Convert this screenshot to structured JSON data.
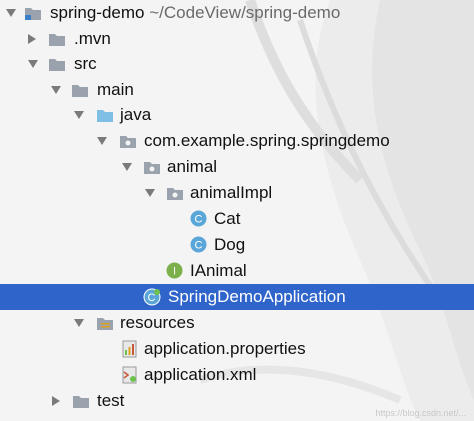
{
  "project": {
    "name": "spring-demo",
    "path": "~/CodeView/spring-demo"
  },
  "items": [
    {
      "label": ".mvn"
    },
    {
      "label": "src"
    },
    {
      "label": "main"
    },
    {
      "label": "java"
    },
    {
      "label": "com.example.spring.springdemo"
    },
    {
      "label": "animal"
    },
    {
      "label": "animalImpl"
    },
    {
      "label": "Cat"
    },
    {
      "label": "Dog"
    },
    {
      "label": "IAnimal"
    },
    {
      "label": "SpringDemoApplication"
    },
    {
      "label": "resources"
    },
    {
      "label": "application.properties"
    },
    {
      "label": "application.xml"
    },
    {
      "label": "test"
    }
  ],
  "icon_letters": {
    "class": "C",
    "interface": "I"
  },
  "watermark": "https://blog.csdn.net/...",
  "colors": {
    "selection": "#2f65ca",
    "folder": "#9aa3ad",
    "source_folder": "#7fbfe6",
    "class_icon": "#5aa6d8",
    "interface_icon": "#7bb04a"
  }
}
